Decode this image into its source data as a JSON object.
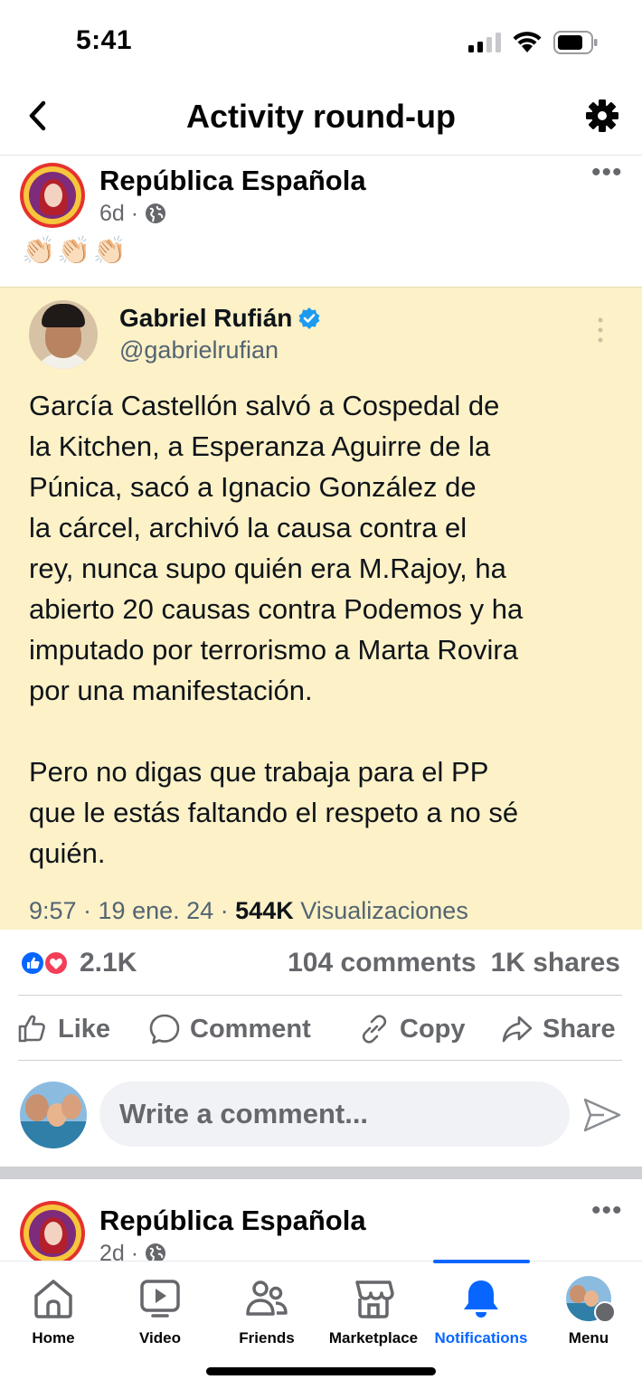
{
  "status_bar": {
    "time": "5:41"
  },
  "header": {
    "title": "Activity round-up"
  },
  "post": {
    "page_name": "República Española",
    "age": "6d",
    "separator": "·",
    "emojis": "👏🏻👏🏻👏🏻"
  },
  "tweet": {
    "author": "Gabriel Rufián",
    "handle": "@gabrielrufian",
    "body": "García Castellón salvó a Cospedal de\nla Kitchen, a Esperanza Aguirre de la\nPúnica, sacó a Ignacio González de\nla cárcel, archivó la causa contra el\nrey, nunca supo quién era M.Rajoy, ha\nabierto 20 causas contra Podemos y ha\nimputado por terrorismo a Marta Rovira\npor una manifestación.\n\nPero no digas que trabaja para el PP\nque le estás faltando el respeto a no sé\nquién.",
    "time": "9:57 · 19 ene. 24 · ",
    "views": "544K",
    "views_label": " Visualizaciones"
  },
  "reactions": {
    "count": "2.1K",
    "comments": "104 comments",
    "shares": "1K shares"
  },
  "actions": {
    "like": "Like",
    "comment": "Comment",
    "copy": "Copy",
    "share": "Share"
  },
  "comment_box": {
    "placeholder": "Write a comment..."
  },
  "next_post": {
    "page_name": "República Española",
    "age": "2d",
    "separator": "·"
  },
  "nav": {
    "home": "Home",
    "video": "Video",
    "friends": "Friends",
    "marketplace": "Marketplace",
    "notifications": "Notifications",
    "menu": "Menu"
  },
  "colors": {
    "accent": "#0866ff",
    "tweet_background": "#fcf1c7",
    "verified": "#1d9bf0",
    "love": "#f33e58"
  }
}
